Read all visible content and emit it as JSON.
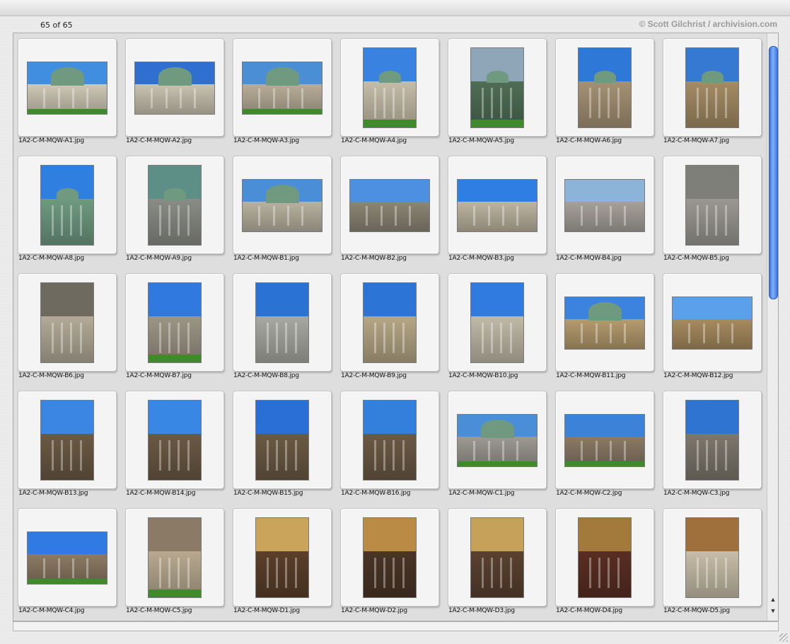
{
  "header": {
    "count": "65 of 65",
    "credit": "© Scott Gilchrist / archivision.com"
  },
  "scrollbar": {
    "up": "▲",
    "down": "▼",
    "position": 0
  },
  "items": [
    {
      "name": "1A2-C-M-MQW-A1.jpg",
      "orient": "landscape",
      "sky": "#3f8ee0",
      "ground": "#cfc8b6",
      "dome": true,
      "grass": true
    },
    {
      "name": "1A2-C-M-MQW-A2.jpg",
      "orient": "landscape",
      "sky": "#2f6fcf",
      "ground": "#c9c3b1",
      "dome": true,
      "grass": false
    },
    {
      "name": "1A2-C-M-MQW-A3.jpg",
      "orient": "landscape",
      "sky": "#4a8fd6",
      "ground": "#b9ad99",
      "dome": true,
      "grass": true
    },
    {
      "name": "1A2-C-M-MQW-A4.jpg",
      "orient": "portrait",
      "sky": "#3a82df",
      "ground": "#c5bda8",
      "dome": true,
      "grass": true
    },
    {
      "name": "1A2-C-M-MQW-A5.jpg",
      "orient": "portrait",
      "sky": "#8fa6b8",
      "ground": "#4f6e55",
      "dome": true,
      "grass": true
    },
    {
      "name": "1A2-C-M-MQW-A6.jpg",
      "orient": "portrait",
      "sky": "#2e78d8",
      "ground": "#a59274",
      "dome": true,
      "grass": false
    },
    {
      "name": "1A2-C-M-MQW-A7.jpg",
      "orient": "portrait",
      "sky": "#3579d3",
      "ground": "#a48c64",
      "dome": true,
      "grass": false
    },
    {
      "name": "1A2-C-M-MQW-A8.jpg",
      "orient": "portrait",
      "sky": "#2f7fe0",
      "ground": "#6f9a80",
      "dome": true,
      "grass": false
    },
    {
      "name": "1A2-C-M-MQW-A9.jpg",
      "orient": "portrait",
      "sky": "#5d8f86",
      "ground": "#8a8c86",
      "dome": true,
      "grass": false
    },
    {
      "name": "1A2-C-M-MQW-B1.jpg",
      "orient": "landscape",
      "sky": "#4a8ed8",
      "ground": "#b9b2a1",
      "dome": true,
      "grass": false
    },
    {
      "name": "1A2-C-M-MQW-B2.jpg",
      "orient": "landscape",
      "sky": "#4d8fe0",
      "ground": "#8d8676",
      "dome": false,
      "grass": false
    },
    {
      "name": "1A2-C-M-MQW-B3.jpg",
      "orient": "landscape",
      "sky": "#2f7ee3",
      "ground": "#bdb4a0",
      "dome": false,
      "grass": false
    },
    {
      "name": "1A2-C-M-MQW-B4.jpg",
      "orient": "landscape",
      "sky": "#8cb3d8",
      "ground": "#a6a29a",
      "dome": false,
      "grass": false
    },
    {
      "name": "1A2-C-M-MQW-B5.jpg",
      "orient": "portrait",
      "sky": "#7f7f7a",
      "ground": "#9a9890",
      "dome": false,
      "grass": false
    },
    {
      "name": "1A2-C-M-MQW-B6.jpg",
      "orient": "portrait",
      "sky": "#6f6a60",
      "ground": "#b3aa98",
      "dome": false,
      "grass": false
    },
    {
      "name": "1A2-C-M-MQW-B7.jpg",
      "orient": "portrait",
      "sky": "#2f79df",
      "ground": "#9c9686",
      "dome": false,
      "grass": true
    },
    {
      "name": "1A2-C-M-MQW-B8.jpg",
      "orient": "portrait",
      "sky": "#2a72d4",
      "ground": "#a8a8a2",
      "dome": false,
      "grass": false
    },
    {
      "name": "1A2-C-M-MQW-B9.jpg",
      "orient": "portrait",
      "sky": "#2c74d6",
      "ground": "#b5a785",
      "dome": false,
      "grass": false
    },
    {
      "name": "1A2-C-M-MQW-B10.jpg",
      "orient": "portrait",
      "sky": "#2f7be0",
      "ground": "#c1b9a8",
      "dome": false,
      "grass": false
    },
    {
      "name": "1A2-C-M-MQW-B11.jpg",
      "orient": "landscape",
      "sky": "#3b83de",
      "ground": "#b59b6e",
      "dome": true,
      "grass": false
    },
    {
      "name": "1A2-C-M-MQW-B12.jpg",
      "orient": "landscape",
      "sky": "#5aa0ea",
      "ground": "#a78b5f",
      "dome": false,
      "grass": false
    },
    {
      "name": "1A2-C-M-MQW-B13.jpg",
      "orient": "portrait",
      "sky": "#3a86e2",
      "ground": "#6b5a44",
      "dome": false,
      "grass": false
    },
    {
      "name": "1A2-C-M-MQW-B14.jpg",
      "orient": "portrait",
      "sky": "#3887e4",
      "ground": "#6b5a44",
      "dome": false,
      "grass": false
    },
    {
      "name": "1A2-C-M-MQW-B15.jpg",
      "orient": "portrait",
      "sky": "#2a6fd6",
      "ground": "#6b5a44",
      "dome": false,
      "grass": false
    },
    {
      "name": "1A2-C-M-MQW-B16.jpg",
      "orient": "portrait",
      "sky": "#3280dc",
      "ground": "#6b5a44",
      "dome": false,
      "grass": false
    },
    {
      "name": "1A2-C-M-MQW-C1.jpg",
      "orient": "landscape",
      "sky": "#4a8ed8",
      "ground": "#9d9a93",
      "dome": true,
      "grass": true
    },
    {
      "name": "1A2-C-M-MQW-C2.jpg",
      "orient": "landscape",
      "sky": "#3b82d8",
      "ground": "#8b7a66",
      "dome": false,
      "grass": true
    },
    {
      "name": "1A2-C-M-MQW-C3.jpg",
      "orient": "portrait",
      "sky": "#2e74d0",
      "ground": "#7d776c",
      "dome": false,
      "grass": false
    },
    {
      "name": "1A2-C-M-MQW-C4.jpg",
      "orient": "landscape",
      "sky": "#2f7be3",
      "ground": "#8c7a63",
      "dome": false,
      "grass": true
    },
    {
      "name": "1A2-C-M-MQW-C5.jpg",
      "orient": "portrait",
      "sky": "#8a7a66",
      "ground": "#b8aa90",
      "dome": false,
      "grass": true
    },
    {
      "name": "1A2-C-M-MQW-D1.jpg",
      "orient": "portrait",
      "sky": "#c9a45a",
      "ground": "#5b3f2a",
      "dome": false,
      "grass": false
    },
    {
      "name": "1A2-C-M-MQW-D2.jpg",
      "orient": "portrait",
      "sky": "#b98b44",
      "ground": "#4a3526",
      "dome": false,
      "grass": false
    },
    {
      "name": "1A2-C-M-MQW-D3.jpg",
      "orient": "portrait",
      "sky": "#c6a15a",
      "ground": "#5a4130",
      "dome": false,
      "grass": false
    },
    {
      "name": "1A2-C-M-MQW-D4.jpg",
      "orient": "portrait",
      "sky": "#a47a3c",
      "ground": "#5a2e22",
      "dome": false,
      "grass": false
    },
    {
      "name": "1A2-C-M-MQW-D5.jpg",
      "orient": "portrait",
      "sky": "#9f6f3c",
      "ground": "#c7bda8",
      "dome": false,
      "grass": false
    }
  ]
}
